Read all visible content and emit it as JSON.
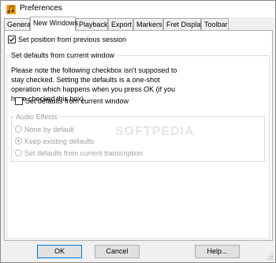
{
  "window": {
    "title": "Preferences",
    "icon": "music-note-icon"
  },
  "tabs": [
    {
      "label": "General",
      "active": false
    },
    {
      "label": "New Windows",
      "active": true
    },
    {
      "label": "Playback",
      "active": false
    },
    {
      "label": "Export",
      "active": false
    },
    {
      "label": "Markers",
      "active": false
    },
    {
      "label": "Fret Display",
      "active": false
    },
    {
      "label": "Toolbar",
      "active": false
    }
  ],
  "panel": {
    "set_position": {
      "label": "Set position from previous session",
      "checked": true
    },
    "defaults_group": {
      "title": "Set defaults from current window",
      "note": "Please note the following checkbox isn't supposed to stay checked. Setting the defaults is a one-shot operation which happens when you press OK (if you have checked this box).",
      "checkbox": {
        "label": "Set defaults from current window",
        "checked": false
      },
      "audio_effects": {
        "title": "Audio Effects",
        "options": [
          {
            "label": "None by default",
            "checked": false
          },
          {
            "label": "Keep existing defaults",
            "checked": true
          },
          {
            "label": "Set defaults from current transcription",
            "checked": false
          }
        ]
      }
    }
  },
  "watermark": "SOFTPEDIA",
  "buttons": {
    "ok": "OK",
    "cancel": "Cancel",
    "help": "Help..."
  }
}
